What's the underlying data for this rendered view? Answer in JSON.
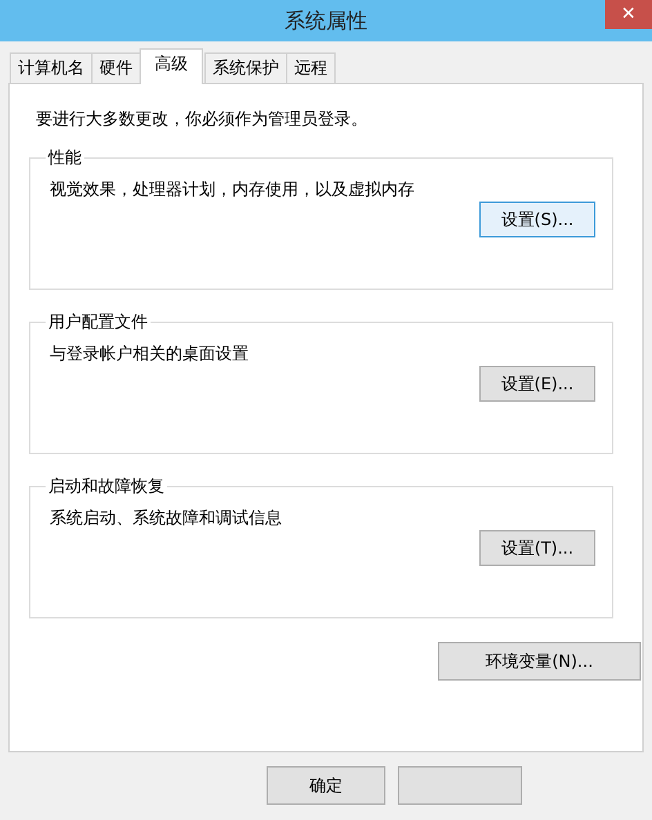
{
  "window": {
    "title": "系统属性",
    "close": "✕"
  },
  "tabs": [
    {
      "label": "计算机名",
      "selected": false
    },
    {
      "label": "硬件",
      "selected": false
    },
    {
      "label": "高级",
      "selected": true
    },
    {
      "label": "系统保护",
      "selected": false
    },
    {
      "label": "远程",
      "selected": false
    }
  ],
  "notice": "要进行大多数更改，你必须作为管理员登录。",
  "groups": [
    {
      "title": "性能",
      "description": "视觉效果，处理器计划，内存使用，以及虚拟内存",
      "button": "设置(S)...",
      "focused": true
    },
    {
      "title": "用户配置文件",
      "description": "与登录帐户相关的桌面设置",
      "button": "设置(E)...",
      "focused": false
    },
    {
      "title": "启动和故障恢复",
      "description": "系统启动、系统故障和调试信息",
      "button": "设置(T)...",
      "focused": false
    }
  ],
  "environment_button": "环境变量(N)...",
  "buttons": [
    "确定"
  ]
}
